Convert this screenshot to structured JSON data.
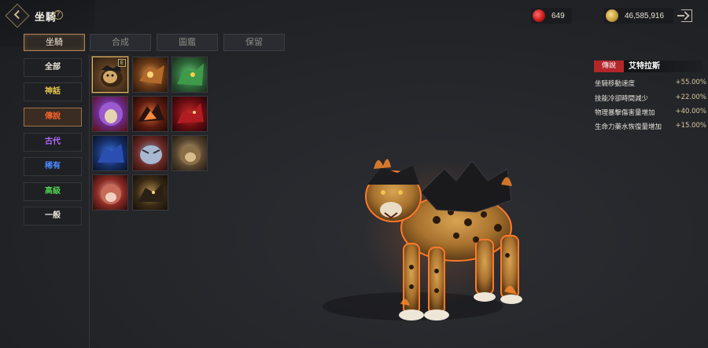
{
  "header": {
    "title": "坐騎",
    "help": "?",
    "gem_amount": "649",
    "gold_amount": "46,585,916"
  },
  "tabs": [
    "坐騎",
    "合成",
    "圖鑑",
    "保留"
  ],
  "active_tab": 0,
  "grades": [
    {
      "label": "全部",
      "color": "#e8e3d8"
    },
    {
      "label": "神話",
      "color": "#e8c84a"
    },
    {
      "label": "傳說",
      "color": "#f0622f"
    },
    {
      "label": "古代",
      "color": "#b46bff"
    },
    {
      "label": "稀有",
      "color": "#4a8bff"
    },
    {
      "label": "高級",
      "color": "#4fcf4f"
    },
    {
      "label": "一般",
      "color": "#e8e3d8"
    }
  ],
  "active_grade": 2,
  "thumbnails": {
    "badge": "E",
    "selected_index": 0
  },
  "detail": {
    "rank_tag": "傳說",
    "name": "艾特拉斯",
    "stats": [
      {
        "label": "坐騎移動速度",
        "value": "+55.00%"
      },
      {
        "label": "技能冷卻時間減少",
        "value": "+22.00%"
      },
      {
        "label": "物理暴擊傷害量增加",
        "value": "+40.00%"
      },
      {
        "label": "生命力藥水恢復量增加",
        "value": "+15.00%"
      }
    ]
  },
  "colors": {
    "accent": "#b5865a",
    "rank_red": "#b3262a",
    "gold": "#d9b56b"
  },
  "icons": [
    "back-chevron-icon",
    "help-icon",
    "ruby-gem-icon",
    "gold-coin-icon",
    "exit-icon",
    "mount-thumbnail"
  ]
}
